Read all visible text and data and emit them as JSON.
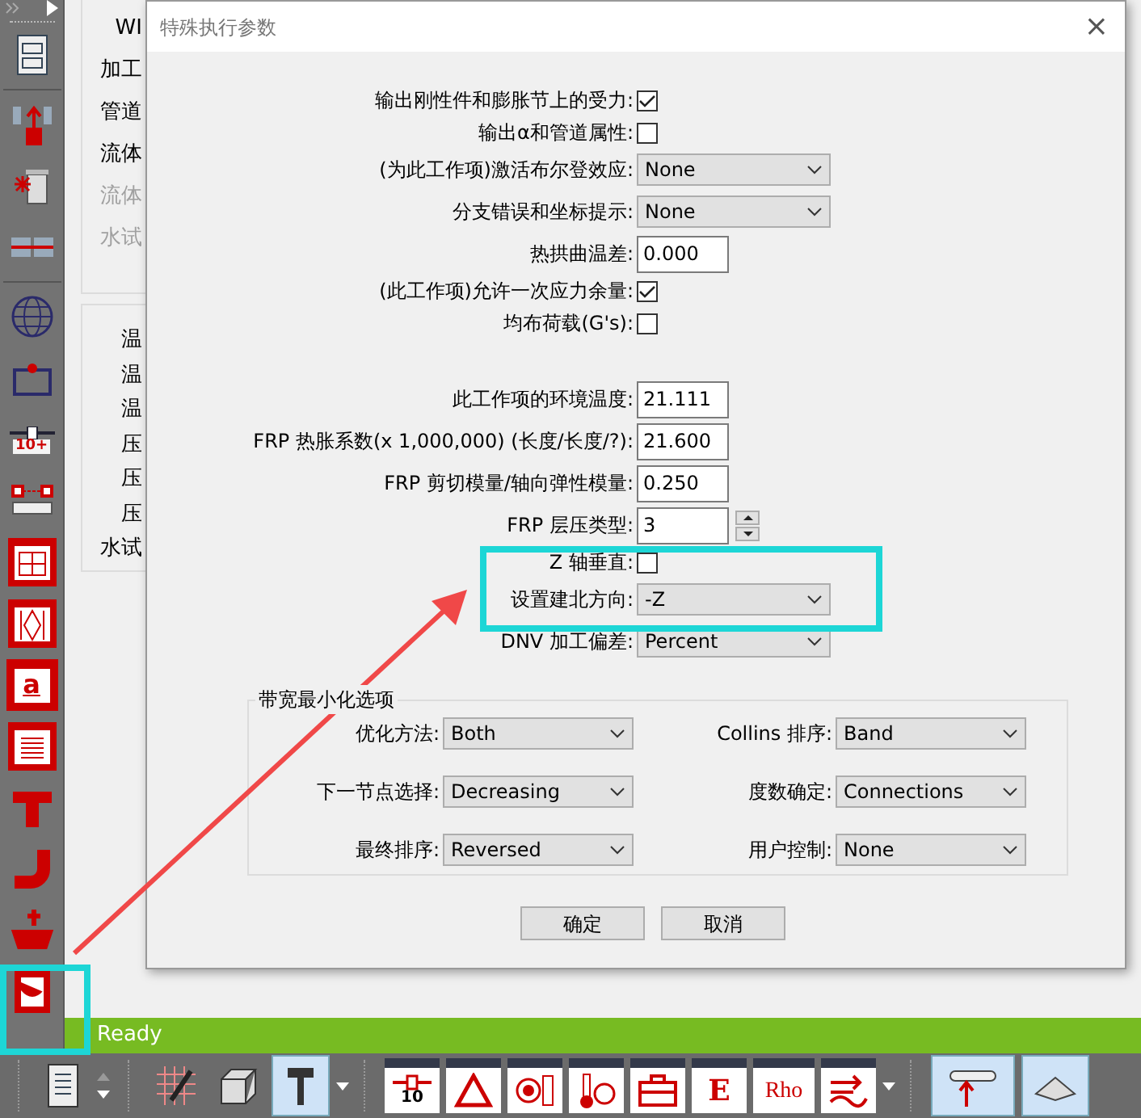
{
  "background_form": {
    "upper_labels": [
      {
        "text": "WI",
        "disabled": false
      },
      {
        "text": "加工",
        "disabled": false
      },
      {
        "text": "管道",
        "disabled": false
      },
      {
        "text": "流体",
        "disabled": false
      },
      {
        "text": "流体",
        "disabled": true
      },
      {
        "text": "水试",
        "disabled": true
      }
    ],
    "lower_labels": [
      {
        "text": "温",
        "disabled": false
      },
      {
        "text": "温",
        "disabled": false
      },
      {
        "text": "温",
        "disabled": false
      },
      {
        "text": "压",
        "disabled": false
      },
      {
        "text": "压",
        "disabled": false
      },
      {
        "text": "压",
        "disabled": false
      },
      {
        "text": "水试",
        "disabled": false
      }
    ]
  },
  "left_toolbar": {
    "slider_label": "10+",
    "letter_label": "a"
  },
  "dialog": {
    "title": "特殊执行参数",
    "close": "×",
    "sections": [
      [
        {
          "kind": "checkbox",
          "label": "输出刚性件和膨胀节上的受力:",
          "checked": true
        },
        {
          "kind": "checkbox",
          "label": "输出α和管道属性:",
          "checked": false
        },
        {
          "kind": "select",
          "label": "(为此工作项)激活布尔登效应:",
          "value": "None"
        },
        {
          "kind": "select",
          "label": "分支错误和坐标提示:",
          "value": "None"
        },
        {
          "kind": "text",
          "label": "热拱曲温差:",
          "value": "0.000"
        },
        {
          "kind": "checkbox",
          "label": "(此工作项)允许一次应力余量:",
          "checked": true
        },
        {
          "kind": "checkbox",
          "label": "均布荷载(G's):",
          "checked": false
        }
      ],
      [
        {
          "kind": "text",
          "label": "此工作项的环境温度:",
          "value": "21.111"
        },
        {
          "kind": "text",
          "label": "FRP 热胀系数(x 1,000,000) (长度/长度/?):",
          "value": "21.600"
        },
        {
          "kind": "text",
          "label": "FRP 剪切模量/轴向弹性模量:",
          "value": "0.250"
        },
        {
          "kind": "spinner",
          "label": "FRP 层压类型:",
          "value": "3"
        },
        {
          "kind": "checkbox",
          "label": "Z 轴垂直:",
          "checked": false
        },
        {
          "kind": "select",
          "label": "设置建北方向:",
          "value": "-Z"
        },
        {
          "kind": "select",
          "label": "DNV 加工偏差:",
          "value": "Percent"
        }
      ]
    ],
    "group": {
      "title": "带宽最小化选项",
      "fields": [
        {
          "label": "优化方法:",
          "value": "Both"
        },
        {
          "label": "Collins 排序:",
          "value": "Band"
        },
        {
          "label": "下一节点选择:",
          "value": "Decreasing"
        },
        {
          "label": "度数确定:",
          "value": "Connections"
        },
        {
          "label": "最终排序:",
          "value": "Reversed"
        },
        {
          "label": "用户控制:",
          "value": "None"
        }
      ]
    },
    "buttons": [
      "确定",
      "取消"
    ]
  },
  "status_bar": {
    "text": "Ready"
  },
  "bottom_toolbar": {
    "node_label": "10",
    "e_label": "E",
    "rho_label": "Rho"
  }
}
